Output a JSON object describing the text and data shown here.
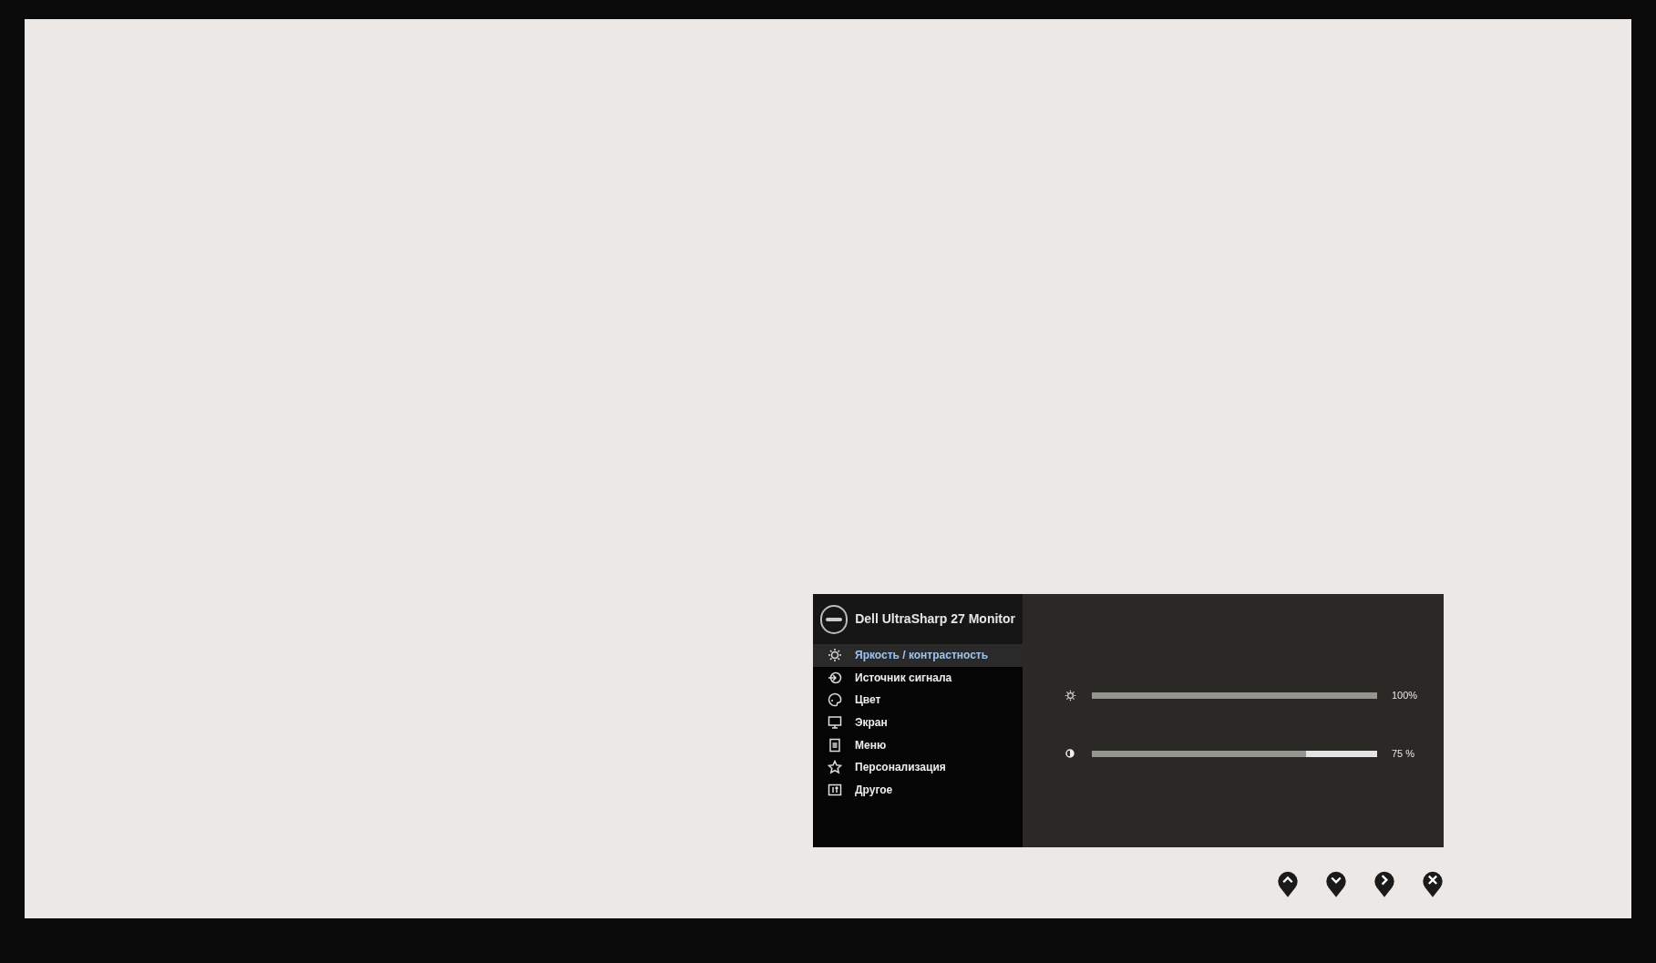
{
  "osd": {
    "title": "Dell UltraSharp 27 Monitor",
    "menu": [
      {
        "label": "Яркость / контрастность",
        "kind": "brightness",
        "selected": true
      },
      {
        "label": "Источник сигнала",
        "kind": "input",
        "selected": false
      },
      {
        "label": "Цвет",
        "kind": "color",
        "selected": false
      },
      {
        "label": "Экран",
        "kind": "display",
        "selected": false
      },
      {
        "label": "Меню",
        "kind": "menu",
        "selected": false
      },
      {
        "label": "Персонализация",
        "kind": "star",
        "selected": false
      },
      {
        "label": "Другое",
        "kind": "other",
        "selected": false
      }
    ],
    "sliders": [
      {
        "kind": "brightness",
        "level": 1,
        "reading": "100%"
      },
      {
        "kind": "contrast",
        "level": 0.75,
        "reading": "75 %"
      }
    ]
  },
  "buttons": [
    {
      "kind": "up"
    },
    {
      "kind": "down"
    },
    {
      "kind": "right"
    },
    {
      "kind": "close"
    }
  ]
}
